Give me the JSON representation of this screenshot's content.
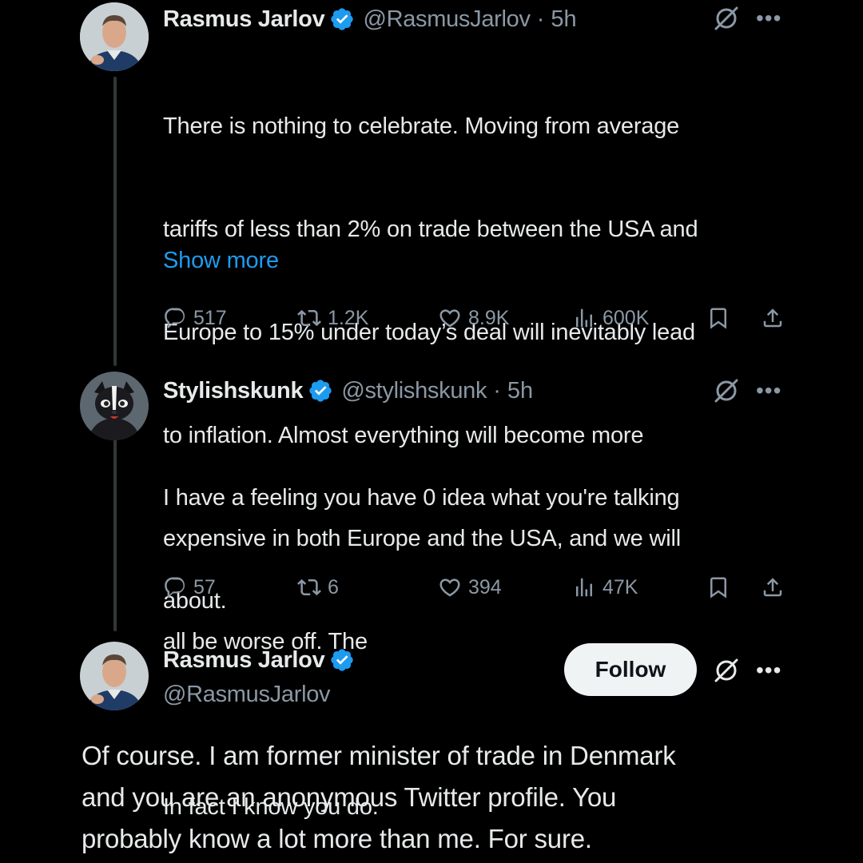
{
  "tweets": [
    {
      "name": "Rasmus Jarlov",
      "handle": "@RasmusJarlov",
      "separator": "·",
      "time": "5h",
      "text_lines": [
        "There is nothing to celebrate. Moving from average",
        "tariffs of less than 2% on trade between the USA and",
        "Europe to 15% under today’s deal will inevitably lead",
        "to inflation. Almost everything will become more",
        "expensive in both Europe and the USA, and we will",
        "all be worse off. The"
      ],
      "show_more": "Show more",
      "replies": "517",
      "reposts": "1.2K",
      "likes": "8.9K",
      "views": "600K"
    },
    {
      "name": "Stylishskunk",
      "handle": "@stylishskunk",
      "separator": "·",
      "time": "5h",
      "text_lines": [
        "I have a feeling you have 0 idea what you're talking",
        "about.",
        "",
        "In fact I know you do."
      ],
      "replies": "57",
      "reposts": "6",
      "likes": "394",
      "views": "47K"
    }
  ],
  "main_tweet": {
    "name": "Rasmus Jarlov",
    "handle": "@RasmusJarlov",
    "follow_label": "Follow",
    "text_lines": [
      "Of course. I am former minister of trade in Denmark",
      "and you are an anonymous Twitter profile. You",
      "probably know a lot more than me. For sure."
    ]
  },
  "icons": {
    "more": "•••",
    "verified": "verified-badge-icon",
    "grok": "grok-icon",
    "reply": "reply-icon",
    "repost": "repost-icon",
    "like": "heart-icon",
    "views": "views-icon",
    "bookmark": "bookmark-icon",
    "share": "share-icon"
  },
  "colors": {
    "background": "#000000",
    "text": "#e7e9ea",
    "secondary": "#8b98a5",
    "link": "#1d9bf0",
    "verified": "#1d9bf0",
    "follow_bg": "#eff3f4"
  }
}
